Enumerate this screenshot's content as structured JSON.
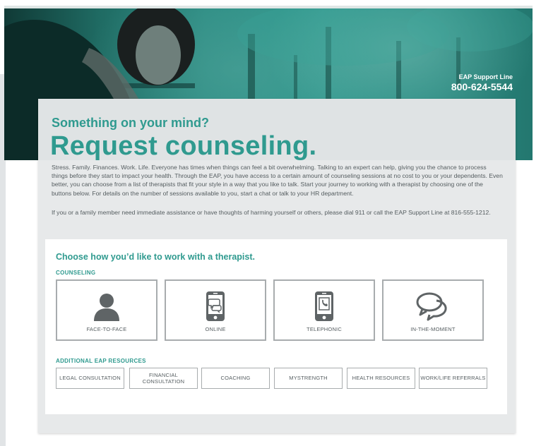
{
  "hero": {
    "support_label": "EAP Support Line",
    "support_phone": "800-624-5544"
  },
  "header": {
    "subtitle": "Something on your mind?",
    "title": "Request counseling."
  },
  "intro": {
    "paragraph1": "Stress. Family. Finances. Work. Life. Everyone has times when things can feel a bit overwhelming. Talking to an expert can help, giving you the chance to process things before they start to impact your health. Through the EAP, you have access to a certain amount of counseling sessions at no cost to you or your dependents. Even better, you can choose from a list of therapists that fit your style in a way that you like to talk. Start your journey to working with a therapist by choosing one of the buttons below. For details on the number of sessions available to you, start a chat or talk to your HR department.",
    "paragraph2": "If you or a family member need immediate assistance or have thoughts of harming yourself or others, please dial 911 or call the EAP Support Line at 816-555-1212."
  },
  "panel": {
    "title": "Choose how you’d like to work with a therapist.",
    "counseling_label": "COUNSELING",
    "counseling_options": [
      {
        "label": "FACE-TO-FACE",
        "icon": "person-icon"
      },
      {
        "label": "ONLINE",
        "icon": "phone-chat-icon"
      },
      {
        "label": "TELEPHONIC",
        "icon": "phone-call-icon"
      },
      {
        "label": "IN-THE-MOMENT",
        "icon": "speech-bubbles-icon"
      }
    ],
    "resources_label": "ADDITIONAL EAP RESOURCES",
    "resources": [
      "LEGAL CONSULTATION",
      "FINANCIAL CONSULTATION",
      "COACHING",
      "MYSTRENGTH",
      "HEALTH RESOURCES",
      "WORK/LIFE REFERRALS"
    ]
  },
  "colors": {
    "accent": "#2f9a8f",
    "hero": "#2c8c83",
    "text": "#555d60",
    "border": "#a8acae",
    "card": "#e7e9ea"
  }
}
